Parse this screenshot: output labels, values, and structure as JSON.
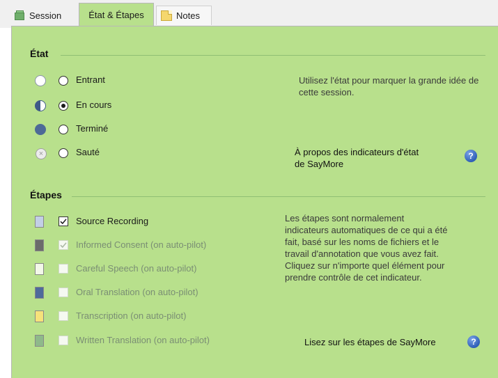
{
  "tabs": [
    {
      "label": "Session",
      "icon": "session-icon"
    },
    {
      "label": "État & Étapes"
    },
    {
      "label": "Notes",
      "icon": "notes-icon"
    }
  ],
  "etat": {
    "title": "État",
    "options": [
      {
        "label": "Entrant",
        "indicator": "empty-circle-icon",
        "selected": false
      },
      {
        "label": "En cours",
        "indicator": "half-circle-icon",
        "selected": true
      },
      {
        "label": "Terminé",
        "indicator": "full-circle-icon",
        "selected": false
      },
      {
        "label": "Sauté",
        "indicator": "skipped-icon",
        "selected": false
      }
    ],
    "help_text": "Utilisez l'état pour marquer la grande idée de cette session.",
    "about_link_line1": "À propos des indicateurs d'état",
    "about_link_line2": "de SayMore"
  },
  "etapes": {
    "title": "Étapes",
    "items": [
      {
        "label": "Source Recording",
        "color": "#c2cfe6",
        "checked": true,
        "enabled": true
      },
      {
        "label": "Informed Consent (on auto-pilot)",
        "color": "#6b6b6b",
        "checked": true,
        "enabled": false
      },
      {
        "label": "Careful Speech (on auto-pilot)",
        "color": "#f3f8e9",
        "checked": false,
        "enabled": false
      },
      {
        "label": "Oral Translation (on auto-pilot)",
        "color": "#4f6a9b",
        "checked": false,
        "enabled": false
      },
      {
        "label": "Transcription (on auto-pilot)",
        "color": "#f6e27a",
        "checked": false,
        "enabled": false
      },
      {
        "label": "Written Translation (on auto-pilot)",
        "color": "#8fb98a",
        "checked": false,
        "enabled": false
      }
    ],
    "help_lines": [
      "Les étapes sont normalement",
      "indicateurs automatiques de ce qui a été",
      "fait, basé sur les noms de fichiers et le",
      "travail d'annotation que vous avez fait.",
      "Cliquez sur n'importe quel élément pour",
      "prendre contrôle de cet indicateur."
    ],
    "read_link": "Lisez sur les étapes de SayMore"
  },
  "colors": {
    "panel_bg": "#b8e08c",
    "help_icon": "#2f5fb8"
  }
}
